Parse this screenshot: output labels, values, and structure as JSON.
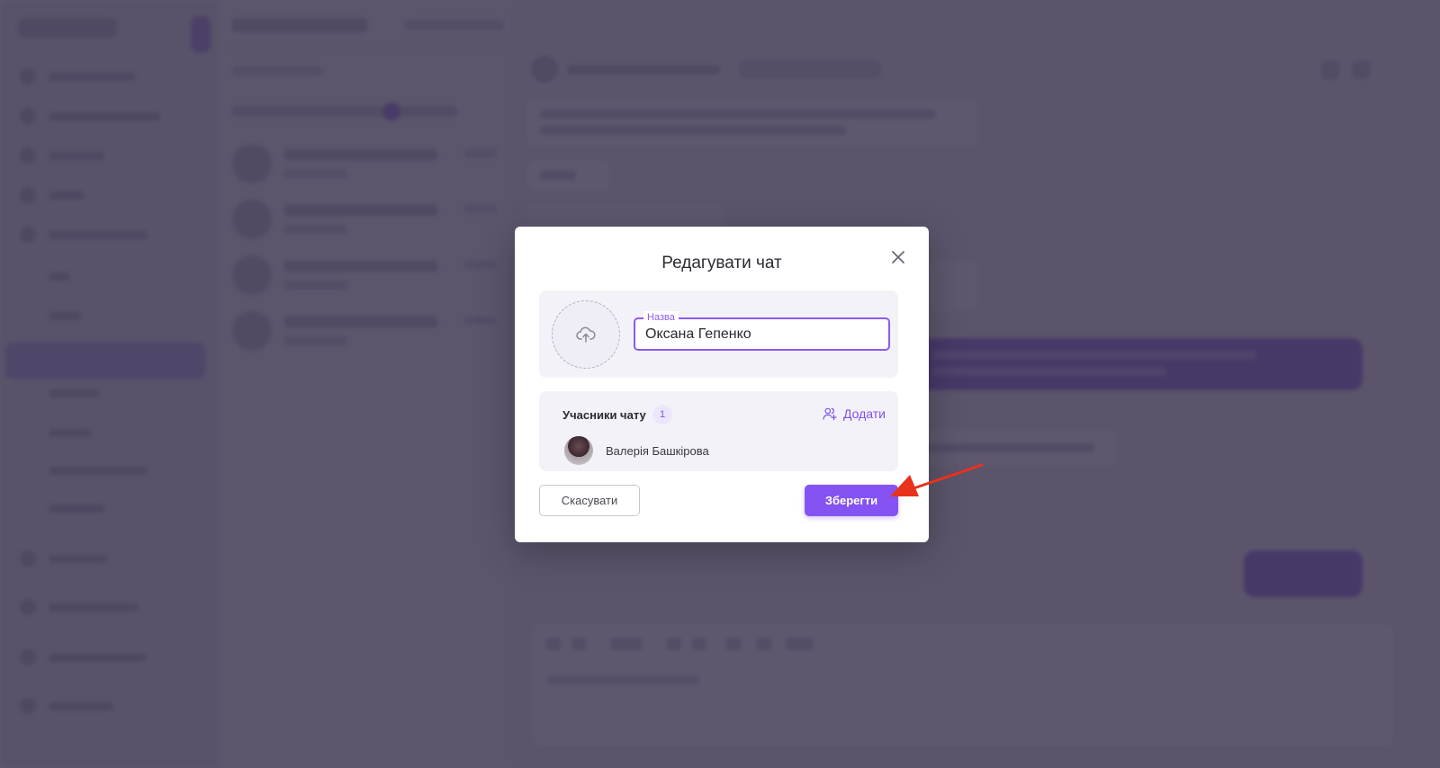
{
  "modal": {
    "title": "Редагувати чат",
    "name_field": {
      "label": "Назва",
      "value": "Оксана Гепенко"
    },
    "members": {
      "title": "Учасники чату",
      "count": "1",
      "add_label": "Додати",
      "items": [
        {
          "name": "Валерія Башкірова"
        }
      ]
    },
    "cancel_label": "Скасувати",
    "save_label": "Зберегти"
  },
  "icons": {
    "close": "close-icon",
    "upload": "cloud-upload-icon",
    "add_user": "add-user-icon",
    "annotation": "red-arrow-icon"
  },
  "colors": {
    "accent": "#8553f2",
    "overlay": "#261c3a",
    "annotation_arrow": "#e8321c"
  }
}
